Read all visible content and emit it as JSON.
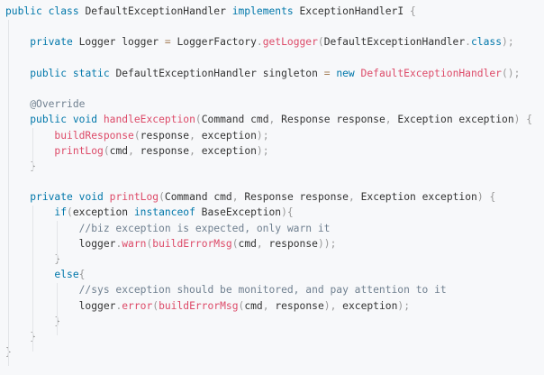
{
  "colors": {
    "background": "#f7f8fa",
    "text": "#333333",
    "keyword": "#0077aa",
    "function": "#dd4a68",
    "comment": "#708090",
    "punctuation": "#999999",
    "operator": "#a67f59",
    "indent_guide": "#e3e5e8"
  },
  "code": {
    "lines": [
      [
        [
          "kw",
          "public"
        ],
        [
          "tx",
          " "
        ],
        [
          "kw",
          "class"
        ],
        [
          "tx",
          " DefaultExceptionHandler "
        ],
        [
          "kw",
          "implements"
        ],
        [
          "tx",
          " ExceptionHandlerI "
        ],
        [
          "pn",
          "{"
        ]
      ],
      [],
      [
        [
          "tx",
          "    "
        ],
        [
          "kw",
          "private"
        ],
        [
          "tx",
          " Logger logger "
        ],
        [
          "op",
          "="
        ],
        [
          "tx",
          " LoggerFactory"
        ],
        [
          "pn",
          "."
        ],
        [
          "fn",
          "getLogger"
        ],
        [
          "pn",
          "("
        ],
        [
          "tx",
          "DefaultExceptionHandler"
        ],
        [
          "pn",
          "."
        ],
        [
          "kw",
          "class"
        ],
        [
          "pn",
          ")"
        ],
        [
          "pn",
          ";"
        ]
      ],
      [],
      [
        [
          "tx",
          "    "
        ],
        [
          "kw",
          "public"
        ],
        [
          "tx",
          " "
        ],
        [
          "kw",
          "static"
        ],
        [
          "tx",
          " DefaultExceptionHandler singleton "
        ],
        [
          "op",
          "="
        ],
        [
          "tx",
          " "
        ],
        [
          "kw",
          "new"
        ],
        [
          "tx",
          " "
        ],
        [
          "fn",
          "DefaultExceptionHandler"
        ],
        [
          "pn",
          "("
        ],
        [
          "pn",
          ")"
        ],
        [
          "pn",
          ";"
        ]
      ],
      [],
      [
        [
          "tx",
          "    "
        ],
        [
          "an",
          "@Override"
        ]
      ],
      [
        [
          "tx",
          "    "
        ],
        [
          "kw",
          "public"
        ],
        [
          "tx",
          " "
        ],
        [
          "kw",
          "void"
        ],
        [
          "tx",
          " "
        ],
        [
          "fn",
          "handleException"
        ],
        [
          "pn",
          "("
        ],
        [
          "tx",
          "Command cmd"
        ],
        [
          "pn",
          ","
        ],
        [
          "tx",
          " Response response"
        ],
        [
          "pn",
          ","
        ],
        [
          "tx",
          " Exception exception"
        ],
        [
          "pn",
          ")"
        ],
        [
          "tx",
          " "
        ],
        [
          "pn",
          "{"
        ]
      ],
      [
        [
          "tx",
          "        "
        ],
        [
          "fn",
          "buildResponse"
        ],
        [
          "pn",
          "("
        ],
        [
          "tx",
          "response"
        ],
        [
          "pn",
          ","
        ],
        [
          "tx",
          " exception"
        ],
        [
          "pn",
          ")"
        ],
        [
          "pn",
          ";"
        ]
      ],
      [
        [
          "tx",
          "        "
        ],
        [
          "fn",
          "printLog"
        ],
        [
          "pn",
          "("
        ],
        [
          "tx",
          "cmd"
        ],
        [
          "pn",
          ","
        ],
        [
          "tx",
          " response"
        ],
        [
          "pn",
          ","
        ],
        [
          "tx",
          " exception"
        ],
        [
          "pn",
          ")"
        ],
        [
          "pn",
          ";"
        ]
      ],
      [
        [
          "tx",
          "    "
        ],
        [
          "pn",
          "}"
        ]
      ],
      [],
      [
        [
          "tx",
          "    "
        ],
        [
          "kw",
          "private"
        ],
        [
          "tx",
          " "
        ],
        [
          "kw",
          "void"
        ],
        [
          "tx",
          " "
        ],
        [
          "fn",
          "printLog"
        ],
        [
          "pn",
          "("
        ],
        [
          "tx",
          "Command cmd"
        ],
        [
          "pn",
          ","
        ],
        [
          "tx",
          " Response response"
        ],
        [
          "pn",
          ","
        ],
        [
          "tx",
          " Exception exception"
        ],
        [
          "pn",
          ")"
        ],
        [
          "tx",
          " "
        ],
        [
          "pn",
          "{"
        ]
      ],
      [
        [
          "tx",
          "        "
        ],
        [
          "kw",
          "if"
        ],
        [
          "pn",
          "("
        ],
        [
          "tx",
          "exception "
        ],
        [
          "kw",
          "instanceof"
        ],
        [
          "tx",
          " BaseException"
        ],
        [
          "pn",
          ")"
        ],
        [
          "pn",
          "{"
        ]
      ],
      [
        [
          "tx",
          "            "
        ],
        [
          "cm",
          "//biz exception is expected, only warn it"
        ]
      ],
      [
        [
          "tx",
          "            logger"
        ],
        [
          "pn",
          "."
        ],
        [
          "fn",
          "warn"
        ],
        [
          "pn",
          "("
        ],
        [
          "fn",
          "buildErrorMsg"
        ],
        [
          "pn",
          "("
        ],
        [
          "tx",
          "cmd"
        ],
        [
          "pn",
          ","
        ],
        [
          "tx",
          " response"
        ],
        [
          "pn",
          ")"
        ],
        [
          "pn",
          ")"
        ],
        [
          "pn",
          ";"
        ]
      ],
      [
        [
          "tx",
          "        "
        ],
        [
          "pn",
          "}"
        ]
      ],
      [
        [
          "tx",
          "        "
        ],
        [
          "kw",
          "else"
        ],
        [
          "pn",
          "{"
        ]
      ],
      [
        [
          "tx",
          "            "
        ],
        [
          "cm",
          "//sys exception should be monitored, and pay attention to it"
        ]
      ],
      [
        [
          "tx",
          "            logger"
        ],
        [
          "pn",
          "."
        ],
        [
          "fn",
          "error"
        ],
        [
          "pn",
          "("
        ],
        [
          "fn",
          "buildErrorMsg"
        ],
        [
          "pn",
          "("
        ],
        [
          "tx",
          "cmd"
        ],
        [
          "pn",
          ","
        ],
        [
          "tx",
          " response"
        ],
        [
          "pn",
          ")"
        ],
        [
          "pn",
          ","
        ],
        [
          "tx",
          " exception"
        ],
        [
          "pn",
          ")"
        ],
        [
          "pn",
          ";"
        ]
      ],
      [
        [
          "tx",
          "        "
        ],
        [
          "pn",
          "}"
        ]
      ],
      [
        [
          "tx",
          "    "
        ],
        [
          "pn",
          "}"
        ]
      ],
      [
        [
          "pn",
          "}"
        ]
      ]
    ]
  }
}
